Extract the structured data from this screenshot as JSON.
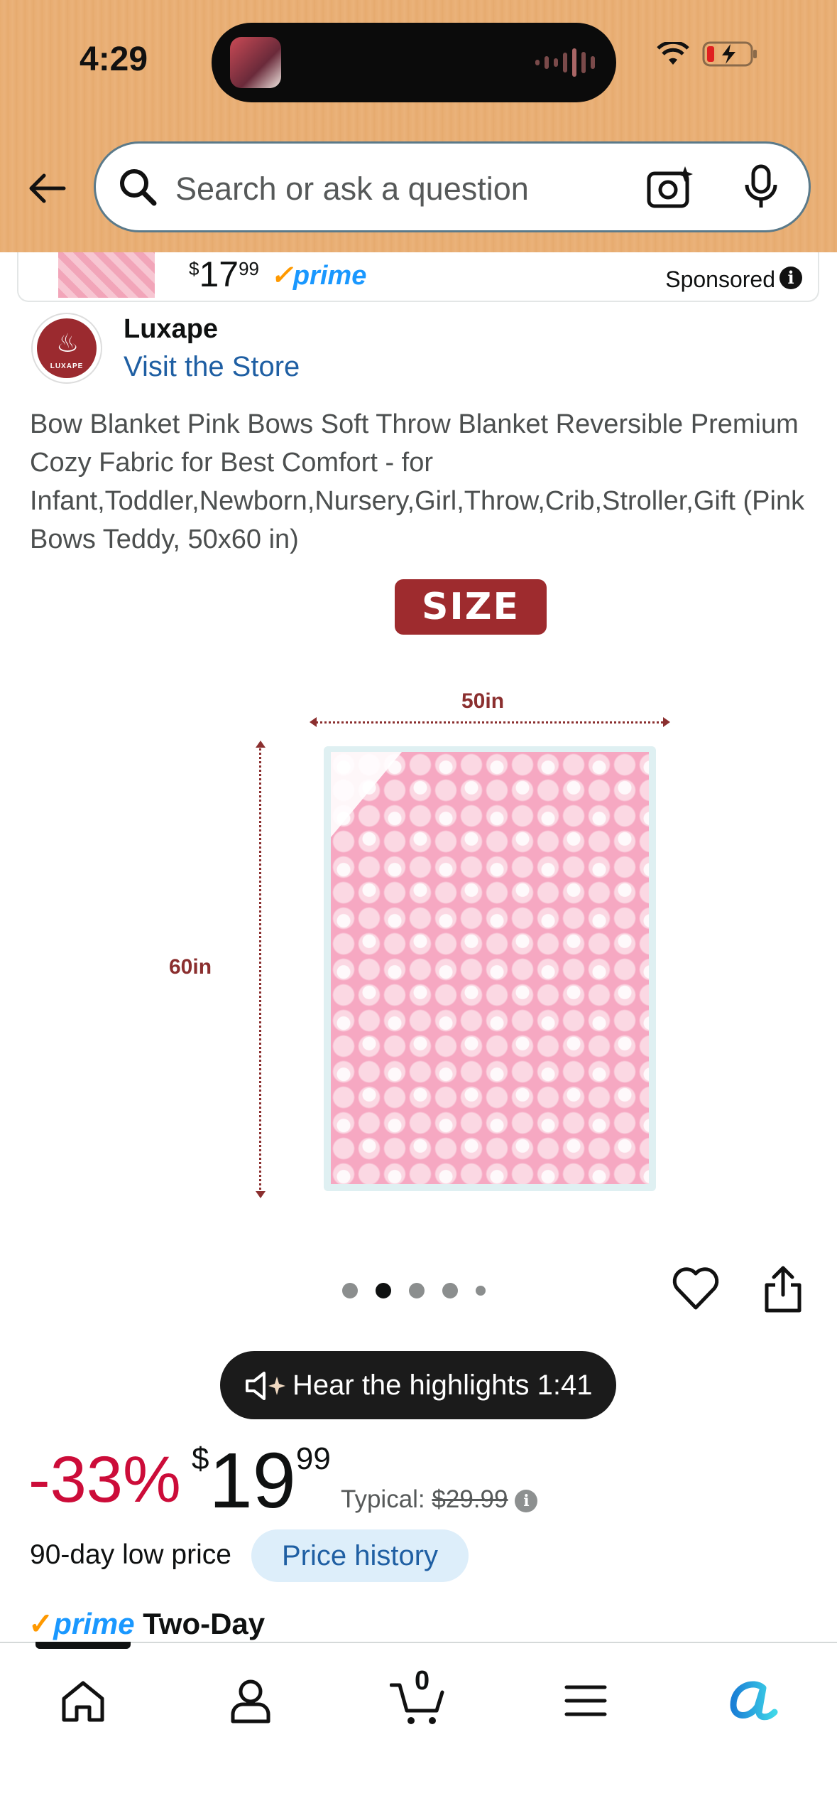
{
  "status_bar": {
    "time": "4:29"
  },
  "search": {
    "placeholder": "Search or ask a question"
  },
  "sponsored": {
    "price_whole": "17",
    "price_fraction": "99",
    "prime": "prime",
    "label": "Sponsored",
    "info": "i"
  },
  "brand": {
    "name": "Luxape",
    "link": "Visit the Store",
    "logo_text": "LUXAPE"
  },
  "product": {
    "title": "Bow Blanket Pink Bows Soft Throw Blanket Reversible Premium Cozy Fabric for Best Comfort - for Infant,Toddler,Newborn,Nursery,Girl,Throw,Crib,Stroller,Gift (Pink Bows Teddy, 50x60 in)"
  },
  "image": {
    "badge": "SIZE",
    "width_label": "50in",
    "height_label": "60in",
    "dots_total": 5,
    "active_dot": 2
  },
  "audio": {
    "label": "Hear the highlights 1:41"
  },
  "price": {
    "discount": "-33%",
    "currency": "$",
    "whole": "19",
    "fraction": "99",
    "typical_label": "Typical:",
    "typical_price": "$29.99",
    "info": "i",
    "low_price_text": "90-day low price",
    "history_button": "Price history"
  },
  "delivery": {
    "prime": "prime",
    "speed": "Two-Day"
  },
  "bottom_nav": {
    "cart_count": "0",
    "items": [
      "home",
      "account",
      "cart",
      "menu",
      "rufus"
    ]
  },
  "colors": {
    "header": "#e8ad72",
    "discount": "#cc0c39",
    "link": "#1f5fa3",
    "badge": "#9e2b2e",
    "prime": "#1a98ff"
  }
}
